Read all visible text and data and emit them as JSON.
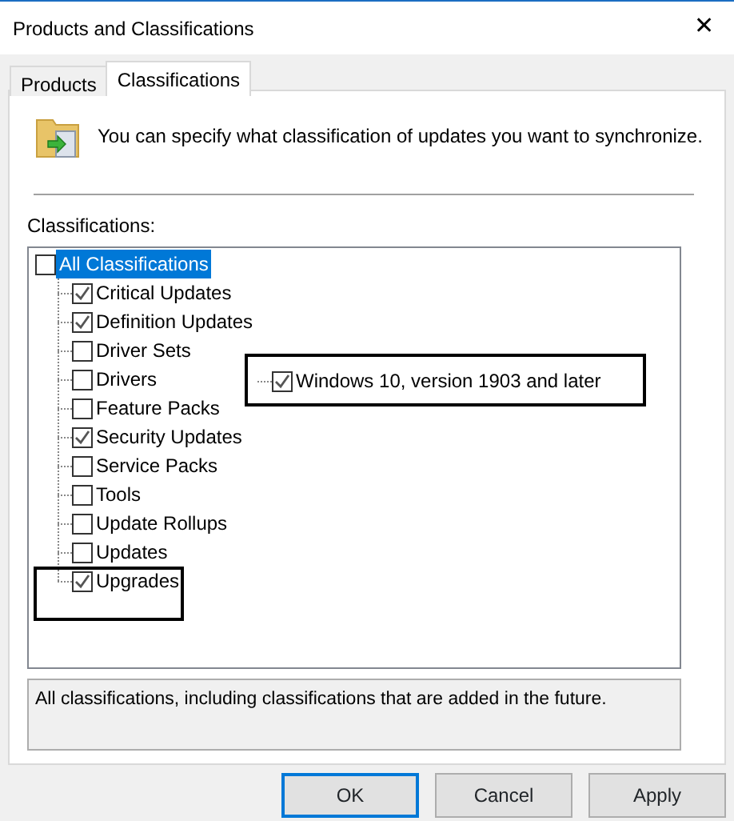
{
  "window": {
    "title": "Products and Classifications",
    "close": "✕"
  },
  "tabs": [
    {
      "label": "Products",
      "selected": false
    },
    {
      "label": "Classifications",
      "selected": true
    }
  ],
  "intro": "You can specify what classification of updates you want to synchronize.",
  "tree_label": "Classifications:",
  "tree": {
    "label": "All Classifications",
    "checked": false,
    "selected": true,
    "children": [
      {
        "label": "Critical Updates",
        "checked": true
      },
      {
        "label": "Definition Updates",
        "checked": true
      },
      {
        "label": "Driver Sets",
        "checked": false
      },
      {
        "label": "Drivers",
        "checked": false
      },
      {
        "label": "Feature Packs",
        "checked": false
      },
      {
        "label": "Security Updates",
        "checked": true
      },
      {
        "label": "Service Packs",
        "checked": false
      },
      {
        "label": "Tools",
        "checked": false
      },
      {
        "label": "Update Rollups",
        "checked": false
      },
      {
        "label": "Updates",
        "checked": false
      },
      {
        "label": "Upgrades",
        "checked": true
      }
    ]
  },
  "inset": {
    "label": "Windows 10, version 1903 and later",
    "checked": true
  },
  "description": "All classifications, including classifications that are added in the future.",
  "buttons": [
    {
      "label": "OK",
      "default": true
    },
    {
      "label": "Cancel",
      "default": false
    },
    {
      "label": "Apply",
      "default": false
    }
  ]
}
